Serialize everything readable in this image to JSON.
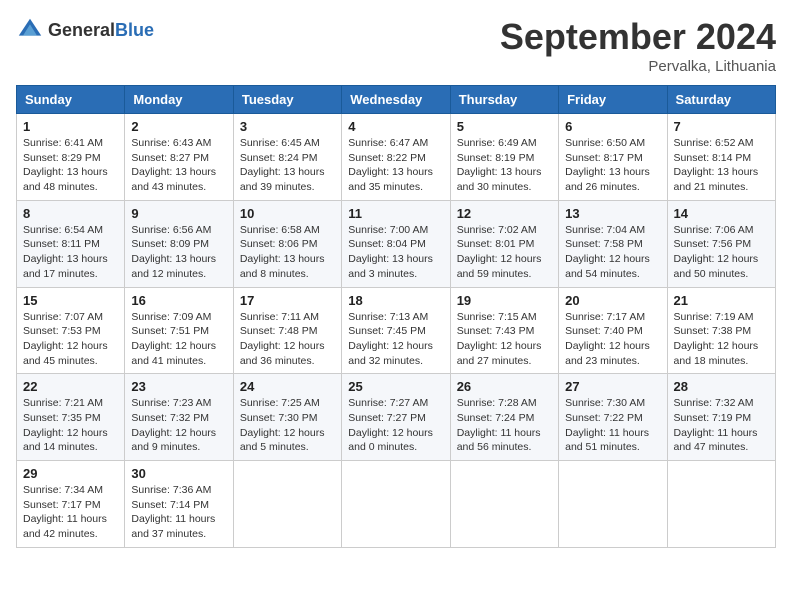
{
  "header": {
    "logo_general": "General",
    "logo_blue": "Blue",
    "month_title": "September 2024",
    "location": "Pervalka, Lithuania"
  },
  "days_of_week": [
    "Sunday",
    "Monday",
    "Tuesday",
    "Wednesday",
    "Thursday",
    "Friday",
    "Saturday"
  ],
  "weeks": [
    [
      {
        "day": "1",
        "info": "Sunrise: 6:41 AM\nSunset: 8:29 PM\nDaylight: 13 hours\nand 48 minutes."
      },
      {
        "day": "2",
        "info": "Sunrise: 6:43 AM\nSunset: 8:27 PM\nDaylight: 13 hours\nand 43 minutes."
      },
      {
        "day": "3",
        "info": "Sunrise: 6:45 AM\nSunset: 8:24 PM\nDaylight: 13 hours\nand 39 minutes."
      },
      {
        "day": "4",
        "info": "Sunrise: 6:47 AM\nSunset: 8:22 PM\nDaylight: 13 hours\nand 35 minutes."
      },
      {
        "day": "5",
        "info": "Sunrise: 6:49 AM\nSunset: 8:19 PM\nDaylight: 13 hours\nand 30 minutes."
      },
      {
        "day": "6",
        "info": "Sunrise: 6:50 AM\nSunset: 8:17 PM\nDaylight: 13 hours\nand 26 minutes."
      },
      {
        "day": "7",
        "info": "Sunrise: 6:52 AM\nSunset: 8:14 PM\nDaylight: 13 hours\nand 21 minutes."
      }
    ],
    [
      {
        "day": "8",
        "info": "Sunrise: 6:54 AM\nSunset: 8:11 PM\nDaylight: 13 hours\nand 17 minutes."
      },
      {
        "day": "9",
        "info": "Sunrise: 6:56 AM\nSunset: 8:09 PM\nDaylight: 13 hours\nand 12 minutes."
      },
      {
        "day": "10",
        "info": "Sunrise: 6:58 AM\nSunset: 8:06 PM\nDaylight: 13 hours\nand 8 minutes."
      },
      {
        "day": "11",
        "info": "Sunrise: 7:00 AM\nSunset: 8:04 PM\nDaylight: 13 hours\nand 3 minutes."
      },
      {
        "day": "12",
        "info": "Sunrise: 7:02 AM\nSunset: 8:01 PM\nDaylight: 12 hours\nand 59 minutes."
      },
      {
        "day": "13",
        "info": "Sunrise: 7:04 AM\nSunset: 7:58 PM\nDaylight: 12 hours\nand 54 minutes."
      },
      {
        "day": "14",
        "info": "Sunrise: 7:06 AM\nSunset: 7:56 PM\nDaylight: 12 hours\nand 50 minutes."
      }
    ],
    [
      {
        "day": "15",
        "info": "Sunrise: 7:07 AM\nSunset: 7:53 PM\nDaylight: 12 hours\nand 45 minutes."
      },
      {
        "day": "16",
        "info": "Sunrise: 7:09 AM\nSunset: 7:51 PM\nDaylight: 12 hours\nand 41 minutes."
      },
      {
        "day": "17",
        "info": "Sunrise: 7:11 AM\nSunset: 7:48 PM\nDaylight: 12 hours\nand 36 minutes."
      },
      {
        "day": "18",
        "info": "Sunrise: 7:13 AM\nSunset: 7:45 PM\nDaylight: 12 hours\nand 32 minutes."
      },
      {
        "day": "19",
        "info": "Sunrise: 7:15 AM\nSunset: 7:43 PM\nDaylight: 12 hours\nand 27 minutes."
      },
      {
        "day": "20",
        "info": "Sunrise: 7:17 AM\nSunset: 7:40 PM\nDaylight: 12 hours\nand 23 minutes."
      },
      {
        "day": "21",
        "info": "Sunrise: 7:19 AM\nSunset: 7:38 PM\nDaylight: 12 hours\nand 18 minutes."
      }
    ],
    [
      {
        "day": "22",
        "info": "Sunrise: 7:21 AM\nSunset: 7:35 PM\nDaylight: 12 hours\nand 14 minutes."
      },
      {
        "day": "23",
        "info": "Sunrise: 7:23 AM\nSunset: 7:32 PM\nDaylight: 12 hours\nand 9 minutes."
      },
      {
        "day": "24",
        "info": "Sunrise: 7:25 AM\nSunset: 7:30 PM\nDaylight: 12 hours\nand 5 minutes."
      },
      {
        "day": "25",
        "info": "Sunrise: 7:27 AM\nSunset: 7:27 PM\nDaylight: 12 hours\nand 0 minutes."
      },
      {
        "day": "26",
        "info": "Sunrise: 7:28 AM\nSunset: 7:24 PM\nDaylight: 11 hours\nand 56 minutes."
      },
      {
        "day": "27",
        "info": "Sunrise: 7:30 AM\nSunset: 7:22 PM\nDaylight: 11 hours\nand 51 minutes."
      },
      {
        "day": "28",
        "info": "Sunrise: 7:32 AM\nSunset: 7:19 PM\nDaylight: 11 hours\nand 47 minutes."
      }
    ],
    [
      {
        "day": "29",
        "info": "Sunrise: 7:34 AM\nSunset: 7:17 PM\nDaylight: 11 hours\nand 42 minutes."
      },
      {
        "day": "30",
        "info": "Sunrise: 7:36 AM\nSunset: 7:14 PM\nDaylight: 11 hours\nand 37 minutes."
      },
      null,
      null,
      null,
      null,
      null
    ]
  ]
}
